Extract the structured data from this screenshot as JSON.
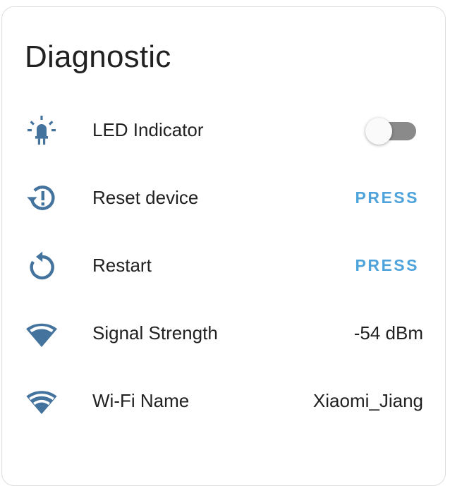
{
  "card": {
    "title": "Diagnostic"
  },
  "rows": [
    {
      "icon": "led-icon",
      "label": "LED Indicator",
      "control": "toggle",
      "toggle_on": false
    },
    {
      "icon": "restore-alert-icon",
      "label": "Reset device",
      "control": "button",
      "action_label": "PRESS"
    },
    {
      "icon": "restart-icon",
      "label": "Restart",
      "control": "button",
      "action_label": "PRESS"
    },
    {
      "icon": "wifi-signal-icon",
      "label": "Signal Strength",
      "control": "value",
      "value": "-54 dBm"
    },
    {
      "icon": "wifi-icon",
      "label": "Wi-Fi Name",
      "control": "value",
      "value": "Xiaomi_Jiang"
    }
  ],
  "colors": {
    "icon": "#44739e",
    "accent": "#4fa3db",
    "text": "#212121",
    "toggle_track": "#8a8a8a"
  }
}
